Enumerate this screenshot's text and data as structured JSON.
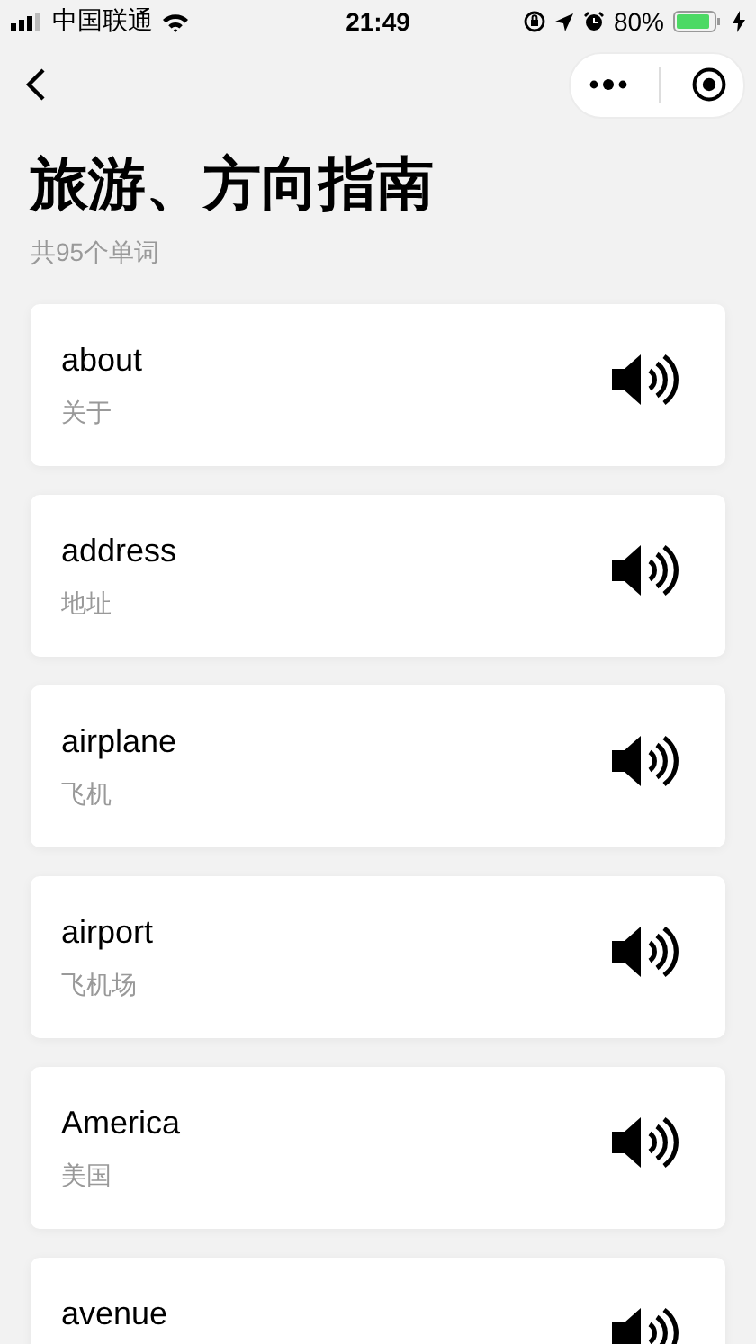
{
  "status_bar": {
    "carrier": "中国联通",
    "time": "21:49",
    "battery": "80%"
  },
  "title": "旅游、方向指南",
  "subtitle": "共95个单词",
  "words": [
    {
      "word": "about",
      "meaning": "关于"
    },
    {
      "word": "address",
      "meaning": "地址"
    },
    {
      "word": "airplane",
      "meaning": "飞机"
    },
    {
      "word": "airport",
      "meaning": "飞机场"
    },
    {
      "word": "America",
      "meaning": "美国"
    },
    {
      "word": "avenue"
    }
  ]
}
